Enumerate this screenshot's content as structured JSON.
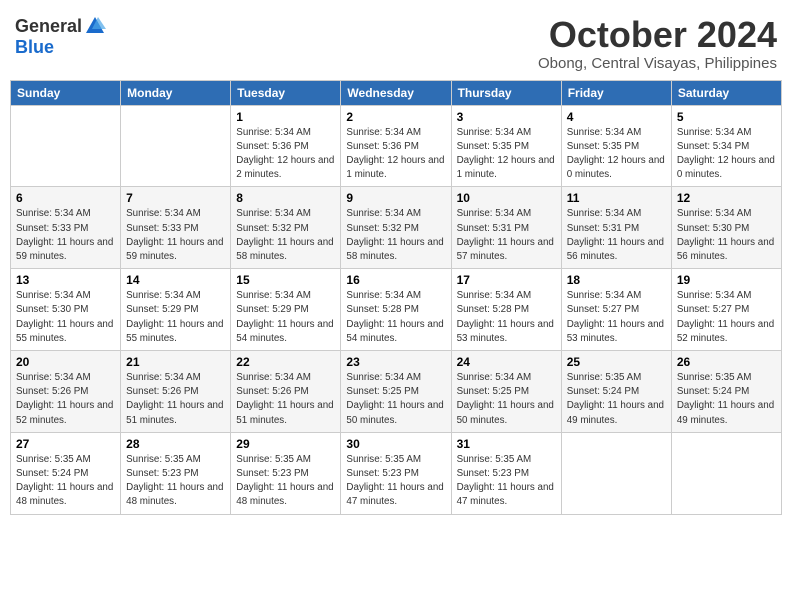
{
  "header": {
    "logo_general": "General",
    "logo_blue": "Blue",
    "month_title": "October 2024",
    "subtitle": "Obong, Central Visayas, Philippines"
  },
  "days_of_week": [
    "Sunday",
    "Monday",
    "Tuesday",
    "Wednesday",
    "Thursday",
    "Friday",
    "Saturday"
  ],
  "weeks": [
    [
      {
        "day": "",
        "sunrise": "",
        "sunset": "",
        "daylight": ""
      },
      {
        "day": "",
        "sunrise": "",
        "sunset": "",
        "daylight": ""
      },
      {
        "day": "1",
        "sunrise": "Sunrise: 5:34 AM",
        "sunset": "Sunset: 5:36 PM",
        "daylight": "Daylight: 12 hours and 2 minutes."
      },
      {
        "day": "2",
        "sunrise": "Sunrise: 5:34 AM",
        "sunset": "Sunset: 5:36 PM",
        "daylight": "Daylight: 12 hours and 1 minute."
      },
      {
        "day": "3",
        "sunrise": "Sunrise: 5:34 AM",
        "sunset": "Sunset: 5:35 PM",
        "daylight": "Daylight: 12 hours and 1 minute."
      },
      {
        "day": "4",
        "sunrise": "Sunrise: 5:34 AM",
        "sunset": "Sunset: 5:35 PM",
        "daylight": "Daylight: 12 hours and 0 minutes."
      },
      {
        "day": "5",
        "sunrise": "Sunrise: 5:34 AM",
        "sunset": "Sunset: 5:34 PM",
        "daylight": "Daylight: 12 hours and 0 minutes."
      }
    ],
    [
      {
        "day": "6",
        "sunrise": "Sunrise: 5:34 AM",
        "sunset": "Sunset: 5:33 PM",
        "daylight": "Daylight: 11 hours and 59 minutes."
      },
      {
        "day": "7",
        "sunrise": "Sunrise: 5:34 AM",
        "sunset": "Sunset: 5:33 PM",
        "daylight": "Daylight: 11 hours and 59 minutes."
      },
      {
        "day": "8",
        "sunrise": "Sunrise: 5:34 AM",
        "sunset": "Sunset: 5:32 PM",
        "daylight": "Daylight: 11 hours and 58 minutes."
      },
      {
        "day": "9",
        "sunrise": "Sunrise: 5:34 AM",
        "sunset": "Sunset: 5:32 PM",
        "daylight": "Daylight: 11 hours and 58 minutes."
      },
      {
        "day": "10",
        "sunrise": "Sunrise: 5:34 AM",
        "sunset": "Sunset: 5:31 PM",
        "daylight": "Daylight: 11 hours and 57 minutes."
      },
      {
        "day": "11",
        "sunrise": "Sunrise: 5:34 AM",
        "sunset": "Sunset: 5:31 PM",
        "daylight": "Daylight: 11 hours and 56 minutes."
      },
      {
        "day": "12",
        "sunrise": "Sunrise: 5:34 AM",
        "sunset": "Sunset: 5:30 PM",
        "daylight": "Daylight: 11 hours and 56 minutes."
      }
    ],
    [
      {
        "day": "13",
        "sunrise": "Sunrise: 5:34 AM",
        "sunset": "Sunset: 5:30 PM",
        "daylight": "Daylight: 11 hours and 55 minutes."
      },
      {
        "day": "14",
        "sunrise": "Sunrise: 5:34 AM",
        "sunset": "Sunset: 5:29 PM",
        "daylight": "Daylight: 11 hours and 55 minutes."
      },
      {
        "day": "15",
        "sunrise": "Sunrise: 5:34 AM",
        "sunset": "Sunset: 5:29 PM",
        "daylight": "Daylight: 11 hours and 54 minutes."
      },
      {
        "day": "16",
        "sunrise": "Sunrise: 5:34 AM",
        "sunset": "Sunset: 5:28 PM",
        "daylight": "Daylight: 11 hours and 54 minutes."
      },
      {
        "day": "17",
        "sunrise": "Sunrise: 5:34 AM",
        "sunset": "Sunset: 5:28 PM",
        "daylight": "Daylight: 11 hours and 53 minutes."
      },
      {
        "day": "18",
        "sunrise": "Sunrise: 5:34 AM",
        "sunset": "Sunset: 5:27 PM",
        "daylight": "Daylight: 11 hours and 53 minutes."
      },
      {
        "day": "19",
        "sunrise": "Sunrise: 5:34 AM",
        "sunset": "Sunset: 5:27 PM",
        "daylight": "Daylight: 11 hours and 52 minutes."
      }
    ],
    [
      {
        "day": "20",
        "sunrise": "Sunrise: 5:34 AM",
        "sunset": "Sunset: 5:26 PM",
        "daylight": "Daylight: 11 hours and 52 minutes."
      },
      {
        "day": "21",
        "sunrise": "Sunrise: 5:34 AM",
        "sunset": "Sunset: 5:26 PM",
        "daylight": "Daylight: 11 hours and 51 minutes."
      },
      {
        "day": "22",
        "sunrise": "Sunrise: 5:34 AM",
        "sunset": "Sunset: 5:26 PM",
        "daylight": "Daylight: 11 hours and 51 minutes."
      },
      {
        "day": "23",
        "sunrise": "Sunrise: 5:34 AM",
        "sunset": "Sunset: 5:25 PM",
        "daylight": "Daylight: 11 hours and 50 minutes."
      },
      {
        "day": "24",
        "sunrise": "Sunrise: 5:34 AM",
        "sunset": "Sunset: 5:25 PM",
        "daylight": "Daylight: 11 hours and 50 minutes."
      },
      {
        "day": "25",
        "sunrise": "Sunrise: 5:35 AM",
        "sunset": "Sunset: 5:24 PM",
        "daylight": "Daylight: 11 hours and 49 minutes."
      },
      {
        "day": "26",
        "sunrise": "Sunrise: 5:35 AM",
        "sunset": "Sunset: 5:24 PM",
        "daylight": "Daylight: 11 hours and 49 minutes."
      }
    ],
    [
      {
        "day": "27",
        "sunrise": "Sunrise: 5:35 AM",
        "sunset": "Sunset: 5:24 PM",
        "daylight": "Daylight: 11 hours and 48 minutes."
      },
      {
        "day": "28",
        "sunrise": "Sunrise: 5:35 AM",
        "sunset": "Sunset: 5:23 PM",
        "daylight": "Daylight: 11 hours and 48 minutes."
      },
      {
        "day": "29",
        "sunrise": "Sunrise: 5:35 AM",
        "sunset": "Sunset: 5:23 PM",
        "daylight": "Daylight: 11 hours and 48 minutes."
      },
      {
        "day": "30",
        "sunrise": "Sunrise: 5:35 AM",
        "sunset": "Sunset: 5:23 PM",
        "daylight": "Daylight: 11 hours and 47 minutes."
      },
      {
        "day": "31",
        "sunrise": "Sunrise: 5:35 AM",
        "sunset": "Sunset: 5:23 PM",
        "daylight": "Daylight: 11 hours and 47 minutes."
      },
      {
        "day": "",
        "sunrise": "",
        "sunset": "",
        "daylight": ""
      },
      {
        "day": "",
        "sunrise": "",
        "sunset": "",
        "daylight": ""
      }
    ]
  ]
}
